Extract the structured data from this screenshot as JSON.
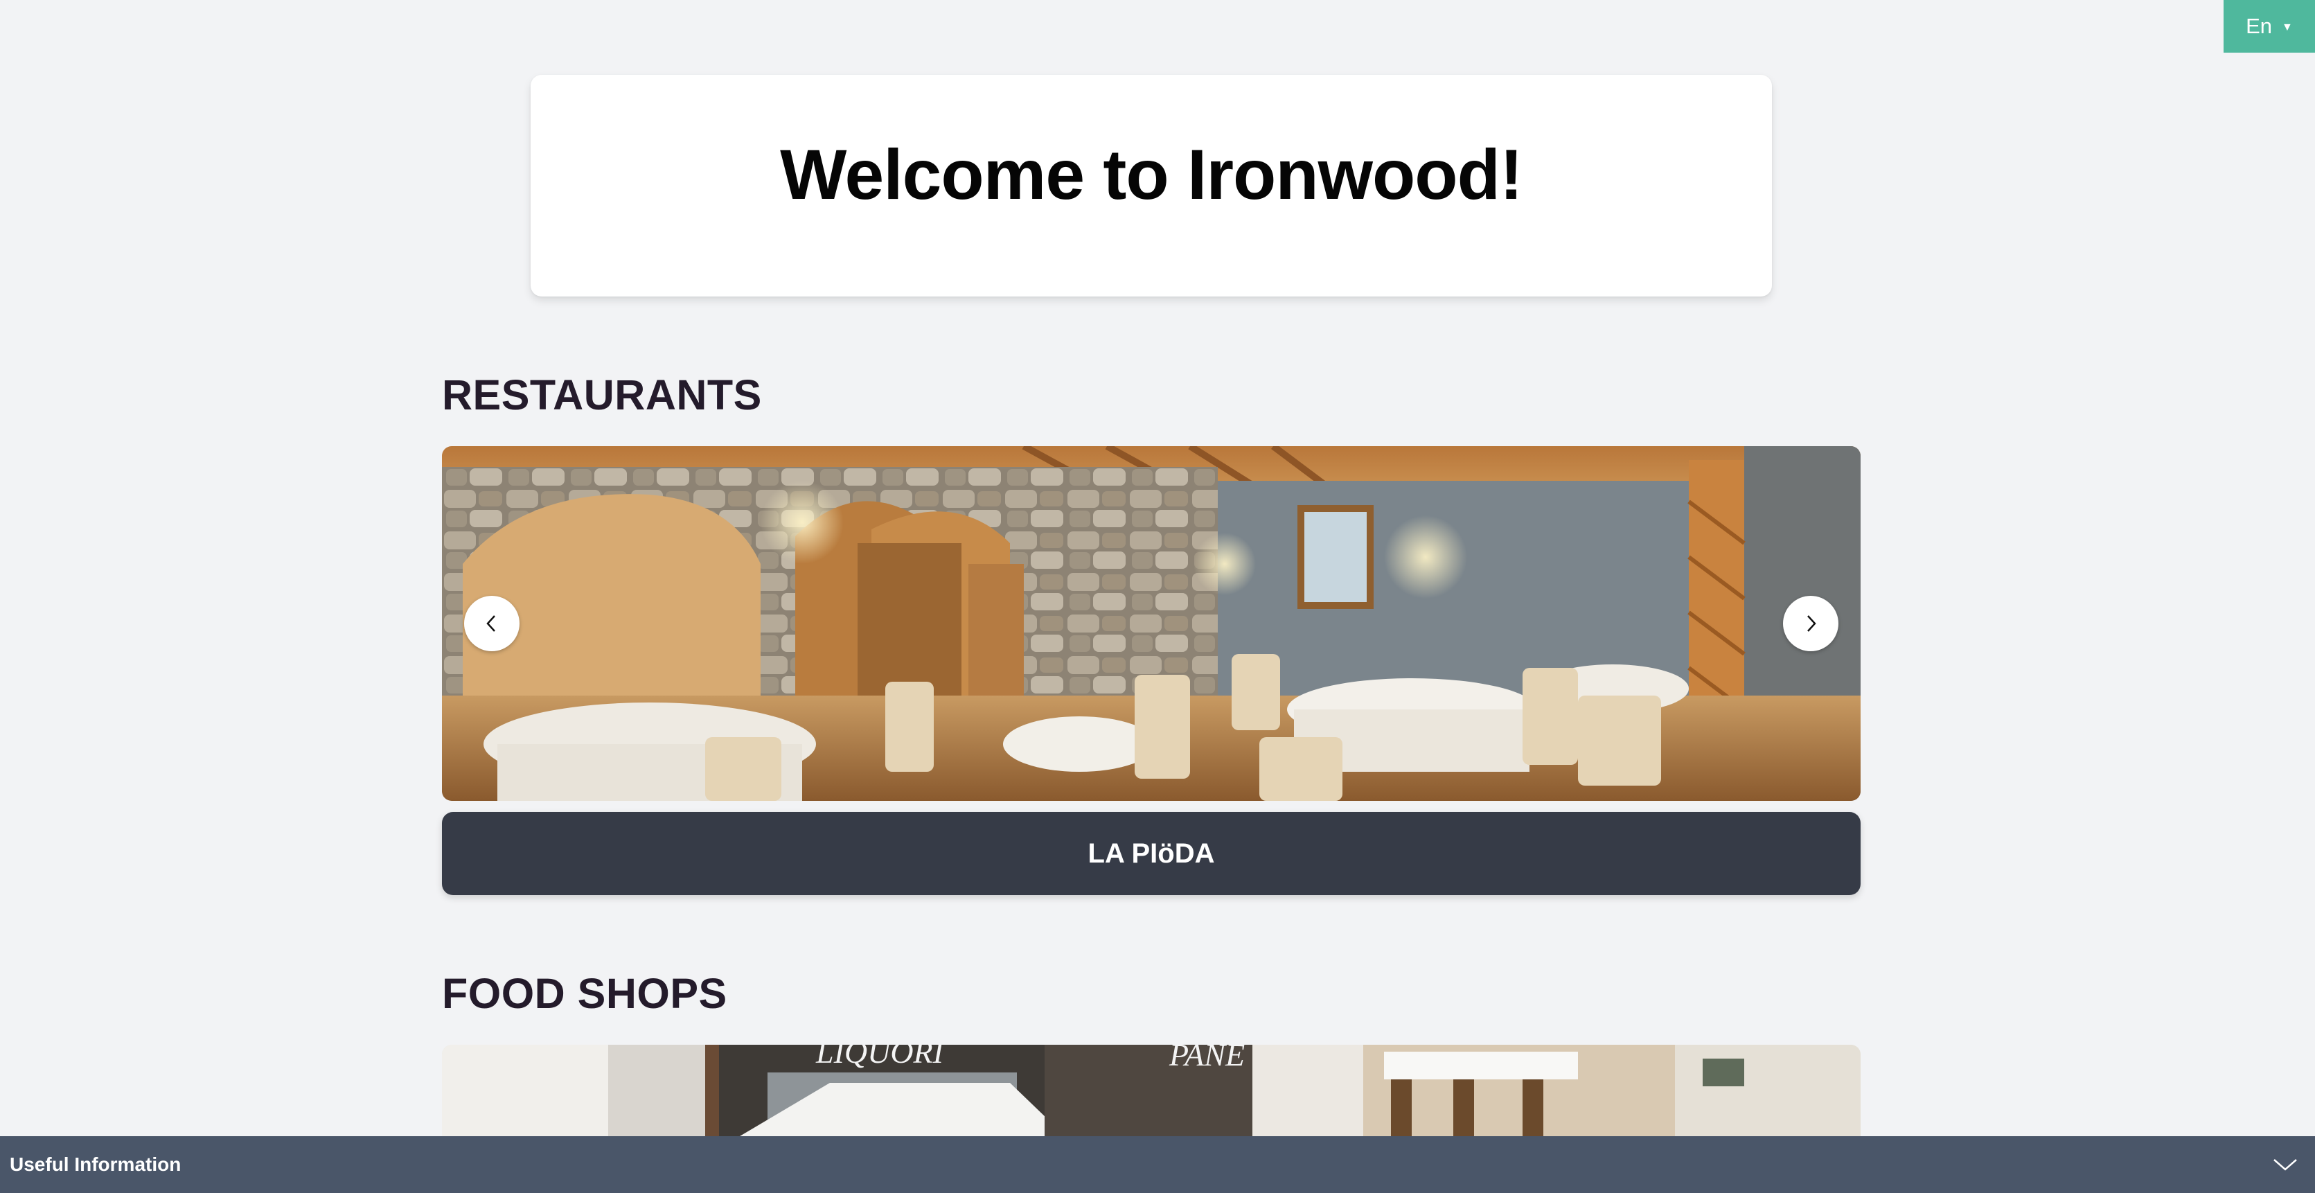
{
  "language": {
    "label": "En",
    "caret_icon": "caret-down-icon"
  },
  "welcome": {
    "title": "Welcome to Ironwood!"
  },
  "sections": {
    "restaurants": {
      "heading": "RESTAURANTS",
      "current_item": "LA PIöDA",
      "prev_icon": "chevron-left-icon",
      "next_icon": "chevron-right-icon"
    },
    "food_shops": {
      "heading": "FOOD SHOPS",
      "sign_left": "LIQUORI",
      "sign_right": "PANE"
    }
  },
  "useful_info": {
    "title": "Useful Information",
    "toggle_icon": "chevron-down-icon"
  },
  "colors": {
    "background": "#f2f3f5",
    "language_button": "#4fb89d",
    "caption_bar": "#363b47",
    "info_bar": "#4a5669",
    "heading": "#241b2b"
  }
}
